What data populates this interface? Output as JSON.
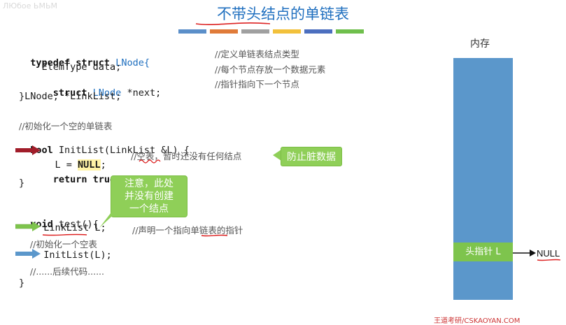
{
  "watermark": "ЛЮбое ЬМЬМ",
  "title": "不带头结点的单链表",
  "title_bars": [
    "#5b8fc9",
    "#e07b39",
    "#a0a0a0",
    "#f2c13b",
    "#4c6fbf",
    "#6fbf4c"
  ],
  "code": {
    "l1_kw": "typedef struct",
    "l1_type": " LNode{",
    "l1_comment": "//定义单链表结点类型",
    "l2_text": "    ElemType data;",
    "l2_comment": "//每个节点存放一个数据元素",
    "l3_kw": "    struct",
    "l3_type": " LNode",
    "l3_text": " *next;",
    "l3_comment": "//指针指向下一个节点",
    "l4_text": "}LNode, *LinkList;",
    "l5_comment": "//初始化一个空的单链表",
    "l6_kw": "bool",
    "l6_text": " InitList(LinkList &L) {",
    "l7_text": "  L = ",
    "l7_null": "NULL",
    "l7_semi": ";",
    "l7_comment": "//空表，暂时还没有任何结点",
    "l8_kw": "    return true",
    "l8_semi": ";",
    "l9_text": "}",
    "l10_kw": "void",
    "l10_text": " test(){",
    "l11_text": "  LinkList L;",
    "l11_comment": "//声明一个指向单链表的指针",
    "l12_comment": "    //初始化一个空表",
    "l13_text": "  InitList(L);",
    "l14_comment": "    //......后续代码......",
    "l15_text": "}"
  },
  "callouts": {
    "dirty": "防止脏数据",
    "note_line1": "注意，此处",
    "note_line2": "并没有创建",
    "note_line3": "一个结点"
  },
  "memory": {
    "label": "内存",
    "head_pointer": "头指针 L",
    "null_label": "NULL"
  },
  "colors": {
    "memory": "#5b97cb",
    "head_pointer": "#7ec44d",
    "red_arrow": "#a11d2a",
    "green_arrow": "#7ec44d",
    "blue_arrow": "#5b97cb"
  },
  "footer": "王道考研/CSKAOYAN.COM"
}
